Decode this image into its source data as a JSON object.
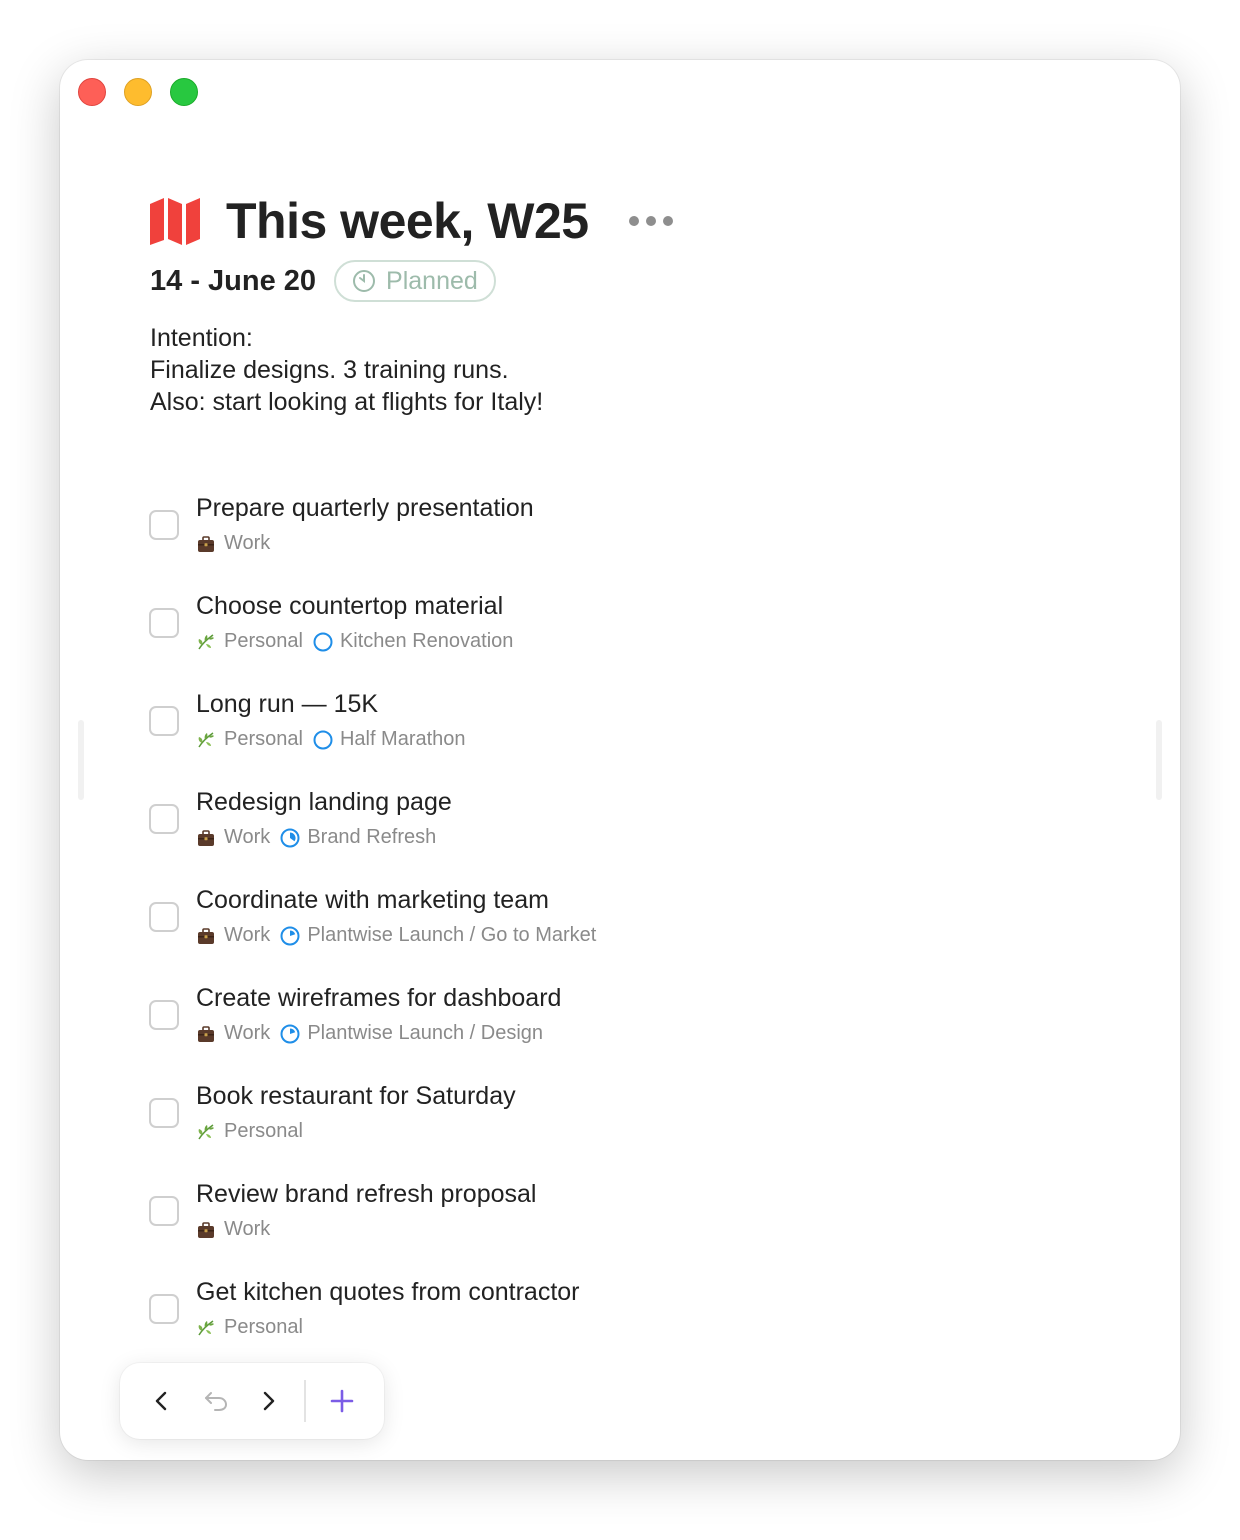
{
  "header": {
    "title": "This week, W25",
    "date_range": "14 - June 20",
    "status": "Planned"
  },
  "intention": {
    "lines": [
      "Intention:",
      "Finalize designs. 3 training runs.",
      "Also: start looking at flights for Italy!"
    ]
  },
  "tasks": [
    {
      "title": "Prepare quarterly presentation",
      "area": "Work",
      "area_icon": "briefcase-icon"
    },
    {
      "title": "Choose countertop material",
      "area": "Personal",
      "area_icon": "leaf-icon",
      "project": "Kitchen Renovation",
      "project_progress": 0
    },
    {
      "title": "Long run — 15K",
      "area": "Personal",
      "area_icon": "leaf-icon",
      "project": "Half Marathon",
      "project_progress": 0
    },
    {
      "title": "Redesign landing page",
      "area": "Work",
      "area_icon": "briefcase-icon",
      "project": "Brand Refresh",
      "project_progress": 0.35
    },
    {
      "title": "Coordinate with marketing team",
      "area": "Work",
      "area_icon": "briefcase-icon",
      "project": "Plantwise Launch / Go to Market",
      "project_progress": 0.2
    },
    {
      "title": "Create wireframes for dashboard",
      "area": "Work",
      "area_icon": "briefcase-icon",
      "project": "Plantwise Launch / Design",
      "project_progress": 0.2
    },
    {
      "title": "Book restaurant for Saturday",
      "area": "Personal",
      "area_icon": "leaf-icon"
    },
    {
      "title": "Review brand refresh proposal",
      "area": "Work",
      "area_icon": "briefcase-icon"
    },
    {
      "title": "Get kitchen quotes from contractor",
      "area": "Personal",
      "area_icon": "leaf-icon"
    }
  ],
  "colors": {
    "accent": "#7b5ce6",
    "map_icon": "#f0413c",
    "project_icon": "#1f8ee8",
    "status_text": "#9dbbab"
  }
}
